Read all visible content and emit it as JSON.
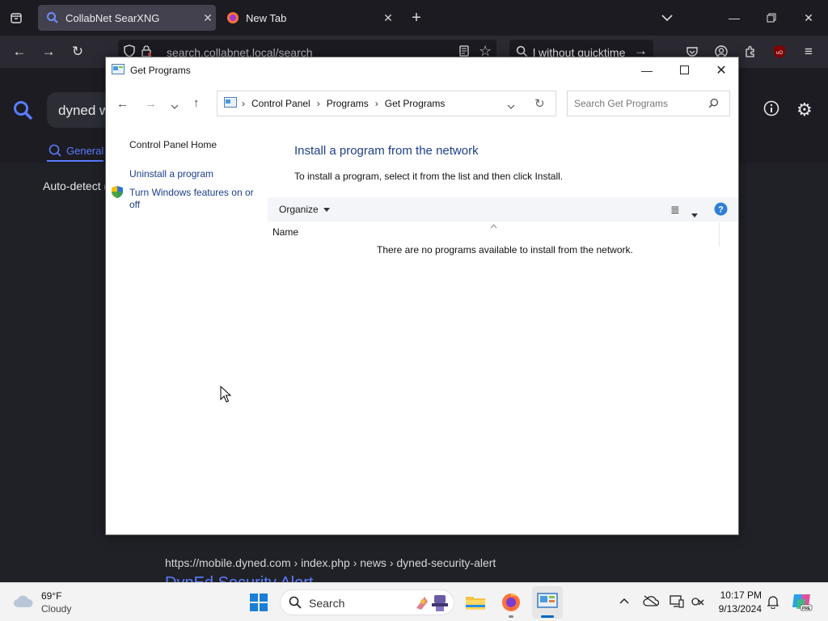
{
  "browser": {
    "tabs": [
      {
        "label": "CollabNet SearXNG",
        "active": true
      },
      {
        "label": "New Tab",
        "active": false
      }
    ],
    "url": "search.collabnet.local/search",
    "search_value": "l without quicktime"
  },
  "page": {
    "query_value": "dyned w",
    "tab_general": "General",
    "auto_detect": "Auto-detect (",
    "result_url": "https://mobile.dyned.com",
    "result_crumbs": "› index.php › news › dyned-security-alert",
    "result_title": "DynEd Security Alert"
  },
  "dialog": {
    "title": "Get Programs",
    "breadcrumb": [
      "Control Panel",
      "Programs",
      "Get Programs"
    ],
    "search_placeholder": "Search Get Programs",
    "sidebar": {
      "home": "Control Panel Home",
      "uninstall": "Uninstall a program",
      "features": "Turn Windows features on or off"
    },
    "heading": "Install a program from the network",
    "instructions": "To install a program, select it from the list and then click Install.",
    "organize": "Organize",
    "column_name": "Name",
    "empty_message": "There are no programs available to install from the network."
  },
  "taskbar": {
    "weather_temp": "69°F",
    "weather_desc": "Cloudy",
    "search_label": "Search",
    "time": "10:17 PM",
    "date": "9/13/2024"
  },
  "colors": {
    "accent": "#0067c0",
    "link": "#1a3f8c",
    "heading": "#1e3f8a",
    "searxng_accent": "#5a7cff"
  }
}
